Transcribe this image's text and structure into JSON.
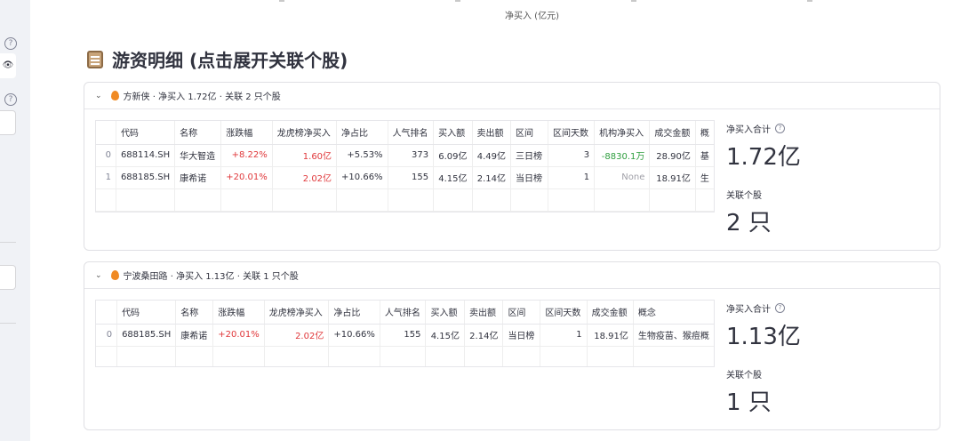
{
  "axis": {
    "label": "净买入 (亿元)"
  },
  "page_title": "游资明细 (点击展开关联个股)",
  "sections": [
    {
      "header": "方新侠 · 净买入 1.72亿 · 关联 2 只个股",
      "columns": [
        "",
        "代码",
        "名称",
        "涨跌幅",
        "龙虎榜净买入",
        "净占比",
        "人气排名",
        "买入额",
        "卖出额",
        "区间",
        "区间天数",
        "机构净买入",
        "成交金额",
        "概"
      ],
      "rows": [
        [
          "0",
          "688114.SH",
          "华大智造",
          "+8.22%",
          "1.60亿",
          "+5.53%",
          "373",
          "6.09亿",
          "4.49亿",
          "三日榜",
          "3",
          "-8830.1万",
          "28.90亿",
          "基"
        ],
        [
          "1",
          "688185.SH",
          "康希诺",
          "+20.01%",
          "2.02亿",
          "+10.66%",
          "155",
          "4.15亿",
          "2.14亿",
          "当日榜",
          "1",
          "None",
          "18.91亿",
          "生"
        ]
      ],
      "metric1_label": "净买入合计",
      "metric1_value": "1.72亿",
      "metric2_label": "关联个股",
      "metric2_value": "2 只"
    },
    {
      "header": "宁波桑田路 · 净买入 1.13亿 · 关联 1 只个股",
      "columns": [
        "",
        "代码",
        "名称",
        "涨跌幅",
        "龙虎榜净买入",
        "净占比",
        "人气排名",
        "买入额",
        "卖出额",
        "区间",
        "区间天数",
        "成交金额",
        "概念"
      ],
      "rows": [
        [
          "0",
          "688185.SH",
          "康希诺",
          "+20.01%",
          "2.02亿",
          "+10.66%",
          "155",
          "4.15亿",
          "2.14亿",
          "当日榜",
          "1",
          "18.91亿",
          "生物疫苗、猴痘概"
        ]
      ],
      "metric1_label": "净买入合计",
      "metric1_value": "1.13亿",
      "metric2_label": "关联个股",
      "metric2_value": "1 只"
    }
  ],
  "icons": {
    "help": "help-circle-icon",
    "eye": "eye-icon",
    "chevron": "chevron-down-icon",
    "fire": "fire-icon",
    "clipboard": "clipboard-icon"
  },
  "colors": {
    "up": "#e0383b",
    "down": "#2e9e3e",
    "none": "#a0a0a8"
  }
}
